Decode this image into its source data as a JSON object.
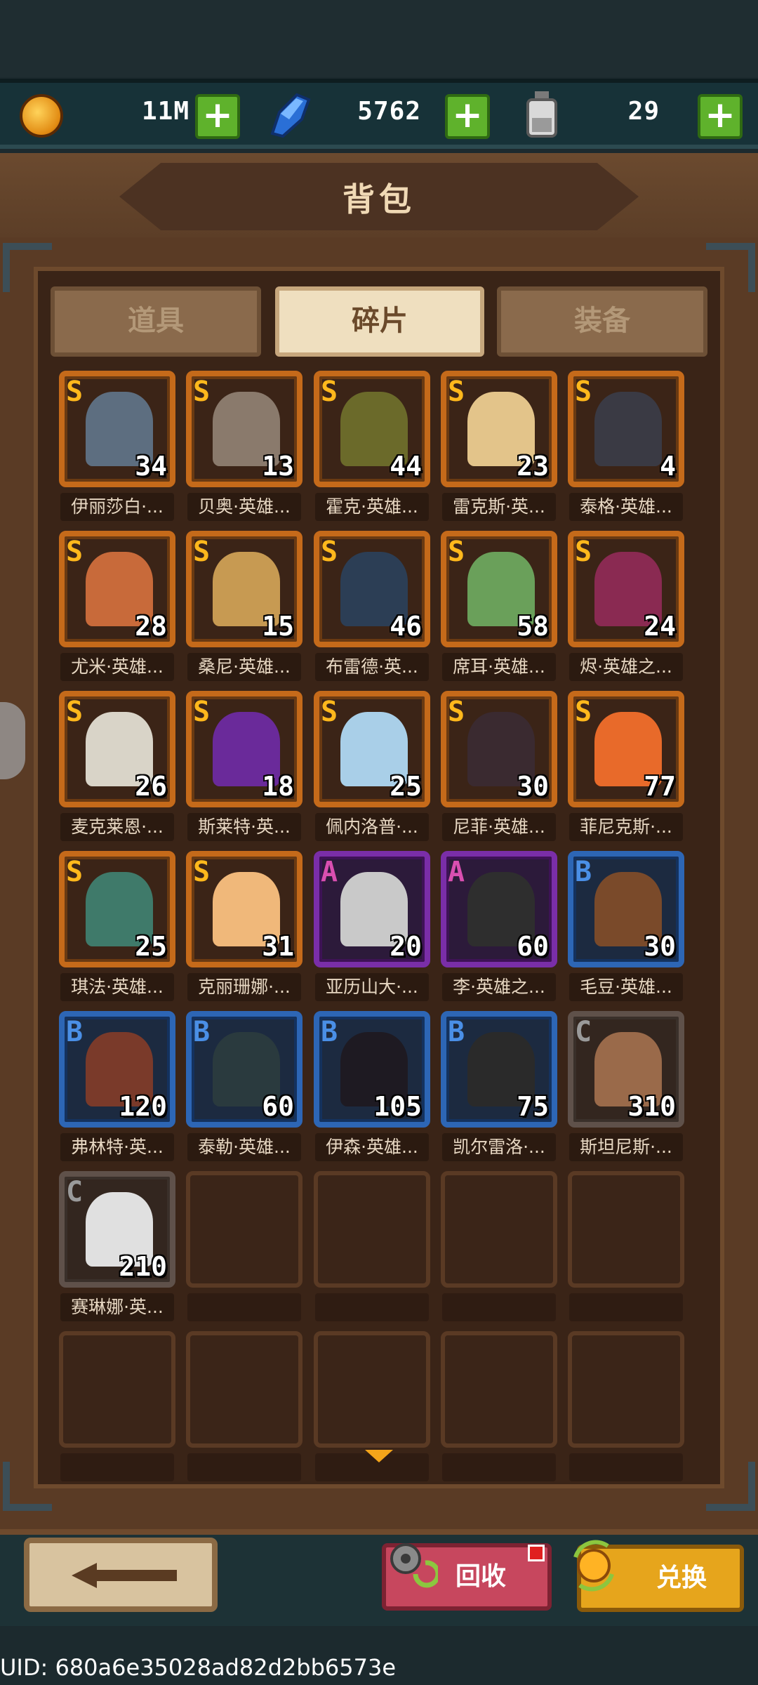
{
  "resources": {
    "gold": {
      "icon": "gold-coin-icon",
      "value": "11M"
    },
    "gems": {
      "icon": "blue-gem-icon",
      "value": "5762"
    },
    "potion": {
      "icon": "potion-bottle-icon",
      "value": "29"
    },
    "plus_symbol": "+"
  },
  "title": "背包",
  "tabs": [
    {
      "label": "道具",
      "active": false
    },
    {
      "label": "碎片",
      "active": true
    },
    {
      "label": "装备",
      "active": false
    }
  ],
  "rarity_colors": {
    "S": "#c56a1a",
    "A": "#7a2ea8",
    "B": "#2d66b5",
    "C": "#5f514a"
  },
  "items": [
    {
      "grade": "S",
      "count": "34",
      "name": "伊丽莎白·...",
      "color": "#5d6e80"
    },
    {
      "grade": "S",
      "count": "13",
      "name": "贝奥·英雄...",
      "color": "#8a7a6c"
    },
    {
      "grade": "S",
      "count": "44",
      "name": "霍克·英雄...",
      "color": "#6b6a2a"
    },
    {
      "grade": "S",
      "count": "23",
      "name": "雷克斯·英...",
      "color": "#e3c48a"
    },
    {
      "grade": "S",
      "count": "4",
      "name": "泰格·英雄...",
      "color": "#3a3a44"
    },
    {
      "grade": "S",
      "count": "28",
      "name": "尤米·英雄...",
      "color": "#c86a3a"
    },
    {
      "grade": "S",
      "count": "15",
      "name": "桑尼·英雄...",
      "color": "#c79a52"
    },
    {
      "grade": "S",
      "count": "46",
      "name": "布雷德·英...",
      "color": "#2c3e55"
    },
    {
      "grade": "S",
      "count": "58",
      "name": "席耳·英雄...",
      "color": "#6aa05a"
    },
    {
      "grade": "S",
      "count": "24",
      "name": "烬·英雄之...",
      "color": "#8a2a52"
    },
    {
      "grade": "S",
      "count": "26",
      "name": "麦克莱恩·...",
      "color": "#d9d4c8"
    },
    {
      "grade": "S",
      "count": "18",
      "name": "斯莱特·英...",
      "color": "#6a2a9a"
    },
    {
      "grade": "S",
      "count": "25",
      "name": "佩内洛普·...",
      "color": "#a9cfe8"
    },
    {
      "grade": "S",
      "count": "30",
      "name": "尼菲·英雄...",
      "color": "#3a2a30"
    },
    {
      "grade": "S",
      "count": "77",
      "name": "菲尼克斯·...",
      "color": "#e86a2a"
    },
    {
      "grade": "S",
      "count": "25",
      "name": "琪法·英雄...",
      "color": "#3f7a6a"
    },
    {
      "grade": "S",
      "count": "31",
      "name": "克丽珊娜·...",
      "color": "#f0b87a"
    },
    {
      "grade": "A",
      "count": "20",
      "name": "亚历山大·...",
      "color": "#c9c9c9"
    },
    {
      "grade": "A",
      "count": "60",
      "name": "李·英雄之...",
      "color": "#2e2e2e"
    },
    {
      "grade": "B",
      "count": "30",
      "name": "毛豆·英雄...",
      "color": "#7a4a2a"
    },
    {
      "grade": "B",
      "count": "120",
      "name": "弗林特·英...",
      "color": "#7a3a2a"
    },
    {
      "grade": "B",
      "count": "60",
      "name": "泰勒·英雄...",
      "color": "#2a3a3e"
    },
    {
      "grade": "B",
      "count": "105",
      "name": "伊森·英雄...",
      "color": "#1e1a22"
    },
    {
      "grade": "B",
      "count": "75",
      "name": "凯尔雷洛·...",
      "color": "#2a2a2a"
    },
    {
      "grade": "C",
      "count": "310",
      "name": "斯坦尼斯·...",
      "color": "#9a6a4a"
    },
    {
      "grade": "C",
      "count": "210",
      "name": "赛琳娜·英...",
      "color": "#e0e0e0"
    }
  ],
  "empty_slots": 9,
  "buttons": {
    "back_icon": "left-arrow-icon",
    "recycle_label": "回收",
    "recycle_icon": "gear-recycle-icon",
    "exchange_label": "兑换",
    "exchange_icon": "coin-exchange-icon"
  },
  "uid": "UID: 680a6e35028ad82d2bb6573e"
}
